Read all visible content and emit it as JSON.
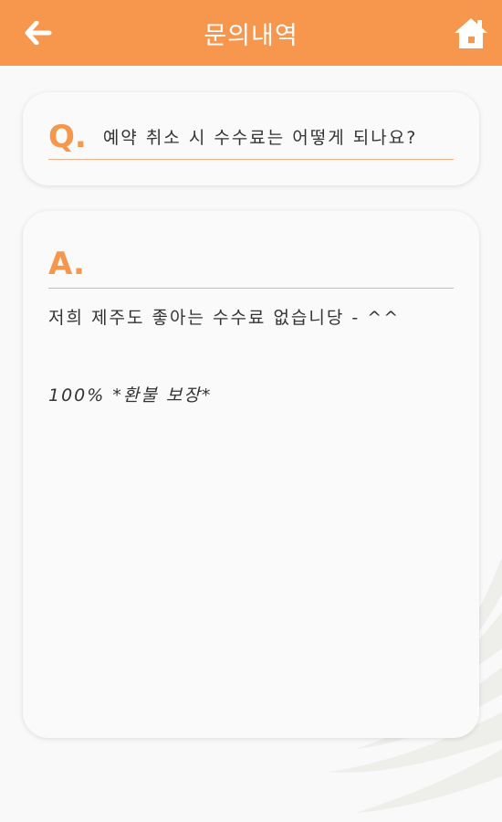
{
  "header": {
    "title": "문의내역",
    "back_icon": "arrow-left-icon",
    "home_icon": "home-icon",
    "color": "#f6974d"
  },
  "question": {
    "mark": "Q.",
    "text": "예약 취소 시 수수료는 어떻게 되나요?"
  },
  "answer": {
    "mark": "A.",
    "lines": [
      "저희 제주도 좋아는 수수료 없습니당 - ^^",
      "100% *환불 보장*"
    ]
  },
  "accent_color": "#f6974d",
  "divider_color": "#f0b08e"
}
